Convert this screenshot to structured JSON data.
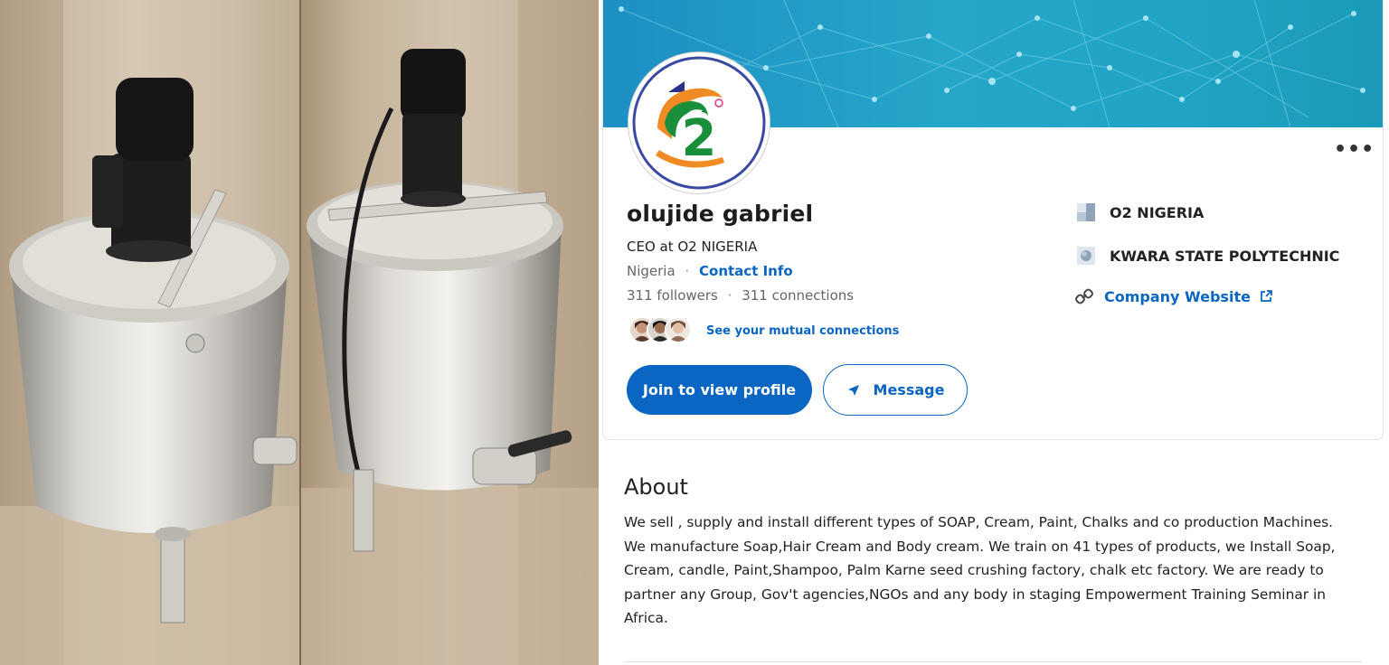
{
  "profile": {
    "name": "olujide gabriel",
    "headline": "CEO at O2 NIGERIA",
    "location": "Nigeria",
    "contact_info": "Contact Info",
    "followers": "311 followers",
    "connections": "311 connections",
    "mutual_connections": "See your mutual connections",
    "more_label": "•••",
    "logo_text": "O2 NIGERIA"
  },
  "actions": {
    "join_label": "Join to view profile",
    "message_label": "Message"
  },
  "sidebar": {
    "company": "O2 NIGERIA",
    "school": "KWARA STATE POLYTECHNIC",
    "website": "Company Website"
  },
  "about": {
    "title": "About",
    "text": "We sell , supply and install different types of SOAP, Cream, Paint, Chalks and co production Machines. We manufacture Soap,Hair Cream and Body cream. We train on 41 types of products, we Install Soap, Cream, candle, Paint,Shampoo, Palm Karne seed crushing factory, chalk etc factory. We are ready to partner any Group, Gov't agencies,NGOs and any body in staging Empowerment Training Seminar in Africa."
  },
  "colors": {
    "accent": "#0a66c2",
    "banner": "#26a7c9",
    "text": "#191919",
    "muted": "#666666"
  },
  "icons": {
    "company": "building-icon",
    "school": "school-icon",
    "website": "link-icon",
    "external": "external-link-icon",
    "message": "send-icon",
    "more": "ellipsis-icon"
  }
}
